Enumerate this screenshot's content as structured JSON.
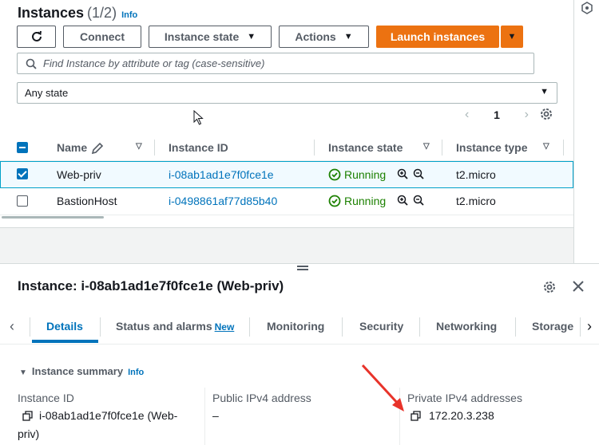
{
  "header": {
    "title": "Instances",
    "count": "(1/2)",
    "info": "Info"
  },
  "toolbar": {
    "connect": "Connect",
    "instance_state": "Instance state",
    "actions": "Actions",
    "launch": "Launch instances"
  },
  "search": {
    "placeholder": "Find Instance by attribute or tag (case-sensitive)"
  },
  "filter": {
    "value": "Any state"
  },
  "pager": {
    "page": "1"
  },
  "table": {
    "columns": [
      "Name",
      "Instance ID",
      "Instance state",
      "Instance type"
    ],
    "rows": [
      {
        "name": "Web-priv",
        "id": "i-08ab1ad1e7f0fce1e",
        "state": "Running",
        "type": "t2.micro",
        "selected": true
      },
      {
        "name": "BastionHost",
        "id": "i-0498861af77d85b40",
        "state": "Running",
        "type": "t2.micro",
        "selected": false
      }
    ]
  },
  "details": {
    "title": "Instance: i-08ab1ad1e7f0fce1e (Web-priv)",
    "tabs": [
      "Details",
      "Status and alarms",
      "Monitoring",
      "Security",
      "Networking",
      "Storage"
    ],
    "new_badge": "New",
    "summary": "Instance summary",
    "summary_info": "Info",
    "fields": {
      "instance_id_label": "Instance ID",
      "instance_id_value_1": "i-08ab1ad1e7f0fce1e (Web-",
      "instance_id_value_2": "priv)",
      "public_ip_label": "Public IPv4 address",
      "public_ip_value": "–",
      "private_ip_label": "Private IPv4 addresses",
      "private_ip_value": "172.20.3.238"
    }
  },
  "colors": {
    "primary": "#ec7211",
    "link": "#0073bb",
    "running": "#1d8102"
  }
}
